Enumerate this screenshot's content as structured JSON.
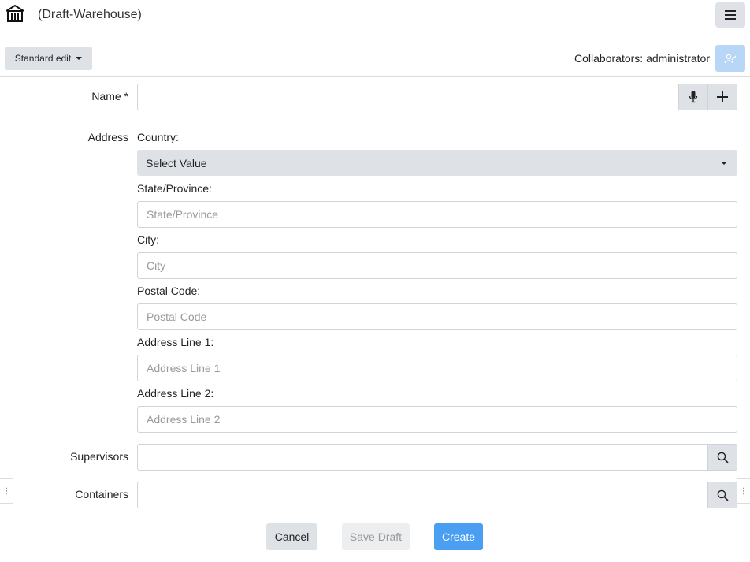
{
  "header": {
    "title": "(Draft-Warehouse)",
    "home_icon": "warehouse-icon",
    "menu_icon": "hamburger-icon"
  },
  "toolbar": {
    "edit_mode_label": "Standard edit",
    "collaborators_text": "Collaborators: administrator",
    "collab_icon": "user-edit-icon"
  },
  "form": {
    "name_label": "Name *",
    "name_value": "",
    "address_label": "Address",
    "country_label": "Country:",
    "country_selected": "Select Value",
    "state_label": "State/Province:",
    "state_placeholder": "State/Province",
    "city_label": "City:",
    "city_placeholder": "City",
    "postal_label": "Postal Code:",
    "postal_placeholder": "Postal Code",
    "line1_label": "Address Line 1:",
    "line1_placeholder": "Address Line 1",
    "line2_label": "Address Line 2:",
    "line2_placeholder": "Address Line 2",
    "supervisors_label": "Supervisors",
    "containers_label": "Containers"
  },
  "actions": {
    "cancel": "Cancel",
    "save_draft": "Save Draft",
    "create": "Create"
  },
  "colors": {
    "primary": "#4a9ff2",
    "button_gray": "#dee1e5",
    "collab_button": "#b8d7f7"
  }
}
